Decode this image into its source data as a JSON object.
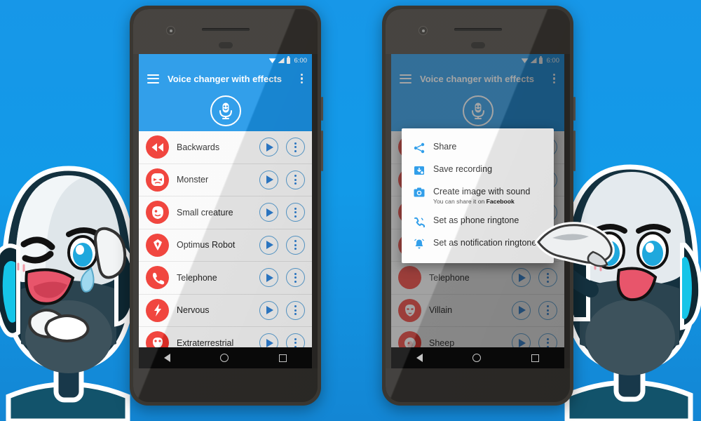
{
  "background": {
    "color_top": "#1797e8",
    "color_bottom": "#1386d4"
  },
  "app": {
    "title": "Voice changer with effects",
    "accent_blue": "#1b94e8",
    "icon_red": "#ef3129",
    "button_blue": "#2f82d6"
  },
  "status_bar": {
    "time": "6:00",
    "icons": [
      "wifi-icon",
      "signal-icon",
      "battery-icon"
    ]
  },
  "appbar": {
    "menu_icon": "hamburger-icon",
    "overflow_icon": "kebab-menu-icon",
    "mic_button_icon": "microphone-icon"
  },
  "left_phone": {
    "effects": [
      {
        "name": "Backwards",
        "icon": "rewind-icon"
      },
      {
        "name": "Monster",
        "icon": "monster-face-icon"
      },
      {
        "name": "Small creature",
        "icon": "small-creature-icon"
      },
      {
        "name": "Optimus Robot",
        "icon": "autobot-icon"
      },
      {
        "name": "Telephone",
        "icon": "telephone-icon"
      },
      {
        "name": "Nervous",
        "icon": "lightning-bolt-icon"
      },
      {
        "name": "Extraterrestrial",
        "icon": "alien-icon"
      }
    ],
    "play_label": "play-icon",
    "more_label": "more-options-icon"
  },
  "right_phone": {
    "effects": [
      {
        "name": "Villain",
        "icon": "villain-mask-icon"
      },
      {
        "name": "Sheep",
        "icon": "sheep-icon"
      }
    ],
    "menu": [
      {
        "label": "Share",
        "sub": "",
        "sub_bold": "",
        "icon": "share-icon"
      },
      {
        "label": "Save recording",
        "sub": "",
        "sub_bold": "",
        "icon": "save-icon"
      },
      {
        "label": "Create image with sound",
        "sub": "You can share it on ",
        "sub_bold": "Facebook",
        "icon": "camera-icon"
      },
      {
        "label": "Set as phone ringtone",
        "sub": "",
        "sub_bold": "",
        "icon": "phone-ring-icon"
      },
      {
        "label": "Set as notification ringtone",
        "sub": "",
        "sub_bold": "",
        "icon": "bell-icon"
      }
    ]
  },
  "navigation_bar": {
    "back": "back-icon",
    "home": "home-icon",
    "recents": "recents-icon"
  },
  "mascots": {
    "left": "microphone-robot-mascot-winking",
    "right": "microphone-robot-mascot-pointing"
  }
}
